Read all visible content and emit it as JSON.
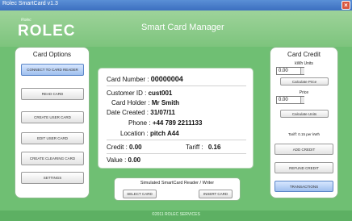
{
  "window": {
    "title": "Rolec SmartCard v1.3"
  },
  "header": {
    "brand": "ROLEC",
    "brand_sub": "Rolec",
    "app_title": "Smart Card Manager"
  },
  "card_options": {
    "title": "Card Options",
    "buttons": [
      "CONNECT TO CARD READER",
      "READ CARD",
      "CREATE USER CARD",
      "EDIT USER CARD",
      "CREATE CLEARING CARD",
      "SETTINGS"
    ]
  },
  "card_info": {
    "card_number_label": "Card Number :",
    "card_number": "00000004",
    "customer_id_label": "Customer ID :",
    "customer_id": "cust001",
    "card_holder_label": "Card Holder :",
    "card_holder": "Mr Smith",
    "date_created_label": "Date Created :",
    "date_created": "31/07/11",
    "phone_label": "Phone :",
    "phone": "+44 789 2211133",
    "location_label": "Location :",
    "location": "pitch A44",
    "credit_label": "Credit :",
    "credit": "0.00",
    "tariff_label": "Tariff :",
    "tariff": "0.16",
    "value_label": "Value :",
    "value": "0.00"
  },
  "simulator": {
    "title": "Simulated SmartCard Reader / Writer",
    "select_card": "SELECT CARD",
    "insert_card": "INSERT CARD"
  },
  "card_credit": {
    "title": "Card Credit",
    "kwh_label": "kWh Units",
    "kwh_value": "0.00",
    "calc_price": "Calculate Price",
    "price_label": "Price",
    "price_value": "0.00",
    "calc_units": "Calculate Units",
    "tariff_text": "Tariff: 0.15 per kWh",
    "add_credit": "ADD CREDIT",
    "refund_credit": "REFUND CREDIT",
    "transactions": "TRANSACTIONS"
  },
  "footer": {
    "text": "©2011 ROLEC SERVICES"
  }
}
